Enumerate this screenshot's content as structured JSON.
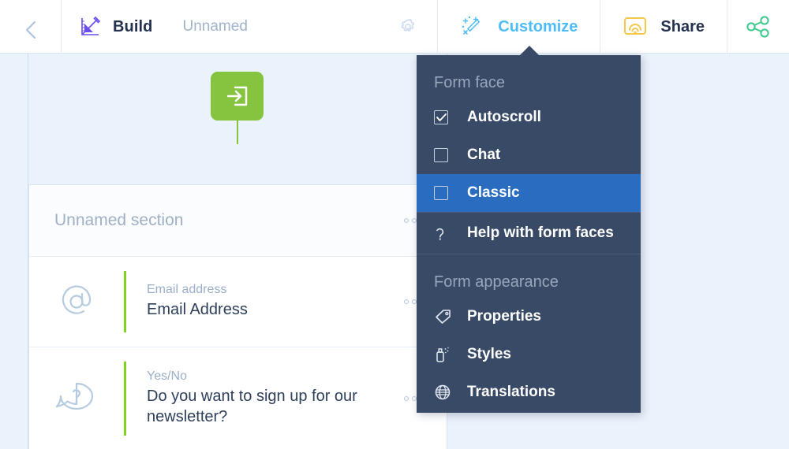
{
  "topbar": {
    "back_icon": "chevron-left-icon",
    "build": {
      "icon": "ruler-pencil-icon",
      "label": "Build"
    },
    "form_name": "Unnamed",
    "gear_icon": "gear-icon",
    "customize": {
      "icon": "magic-wand-icon",
      "label": "Customize"
    },
    "share": {
      "icon": "cast-icon",
      "label": "Share"
    },
    "network_icon": "share-network-icon"
  },
  "canvas": {
    "start_node_icon": "enter-arrow-icon",
    "add_node_icon": "plus-icon",
    "section_title": "Unnamed section",
    "fields": [
      {
        "icon": "at-sign-icon",
        "type": "Email address",
        "name": "Email Address"
      },
      {
        "icon": "question-bubble-icon",
        "type": "Yes/No",
        "name": "Do you want to sign up for our newsletter?"
      }
    ],
    "overflow_menu_icon": "three-dots-icon"
  },
  "panel": {
    "form_face": {
      "title": "Form face",
      "options": [
        {
          "label": "Autoscroll",
          "checked": true,
          "selected": false
        },
        {
          "label": "Chat",
          "checked": false,
          "selected": false
        },
        {
          "label": "Classic",
          "checked": false,
          "selected": true
        }
      ],
      "help": {
        "icon": "question-mark-icon",
        "label": "Help with form faces"
      }
    },
    "form_appearance": {
      "title": "Form appearance",
      "items": [
        {
          "icon": "tag-icon",
          "label": "Properties"
        },
        {
          "icon": "spray-can-icon",
          "label": "Styles"
        },
        {
          "icon": "globe-icon",
          "label": "Translations"
        }
      ]
    }
  },
  "colors": {
    "panel_bg": "#394a66",
    "panel_selected": "#2a6cc0",
    "accent_customize": "#4ebdf7",
    "accent_green": "#86c440",
    "accent_field_bar": "#7ed321",
    "accent_purple": "#6c4df0",
    "accent_yellow": "#f5c84c",
    "accent_network_green": "#3cc98a",
    "canvas_bg": "#eaf2fb",
    "text_dark": "#24314f",
    "text_muted": "#9fb3c9"
  }
}
